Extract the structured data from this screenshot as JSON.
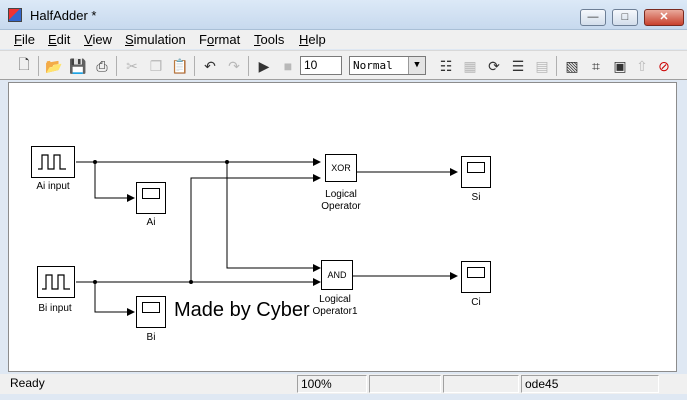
{
  "window": {
    "title": "HalfAdder *"
  },
  "menu": [
    "File",
    "Edit",
    "View",
    "Simulation",
    "Format",
    "Tools",
    "Help"
  ],
  "menu_underline": [
    "F",
    "E",
    "V",
    "S",
    "o",
    "T",
    "H"
  ],
  "toolbar": {
    "stop_time": "10",
    "sim_mode": "Normal",
    "icons": [
      "new-model-icon",
      "open-icon",
      "save-icon",
      "print-icon",
      "cut-icon",
      "copy-icon",
      "paste-icon",
      "undo-icon",
      "redo-icon",
      "start-simulation-icon",
      "stop-simulation-icon",
      "build-icon",
      "update-diagram-icon",
      "refresh-icon",
      "build-subsystem-icon",
      "library-browser-icon",
      "model-explorer-icon",
      "debugger-icon",
      "up-to-parent-icon",
      "toggle-icon"
    ]
  },
  "blocks": {
    "ai_input": "Ai input",
    "bi_input": "Bi input",
    "ai_scope": "Ai",
    "bi_scope": "Bi",
    "xor_gate": "XOR",
    "and_gate": "AND",
    "xor_label_1": "Logical",
    "xor_label_2": "Operator",
    "and_label_1": "Logical",
    "and_label_2": "Operator1",
    "si_scope": "Si",
    "ci_scope": "Ci"
  },
  "watermark": "Made by Cyber",
  "status": {
    "text": "Ready",
    "zoom": "100%",
    "solver": "ode45"
  }
}
